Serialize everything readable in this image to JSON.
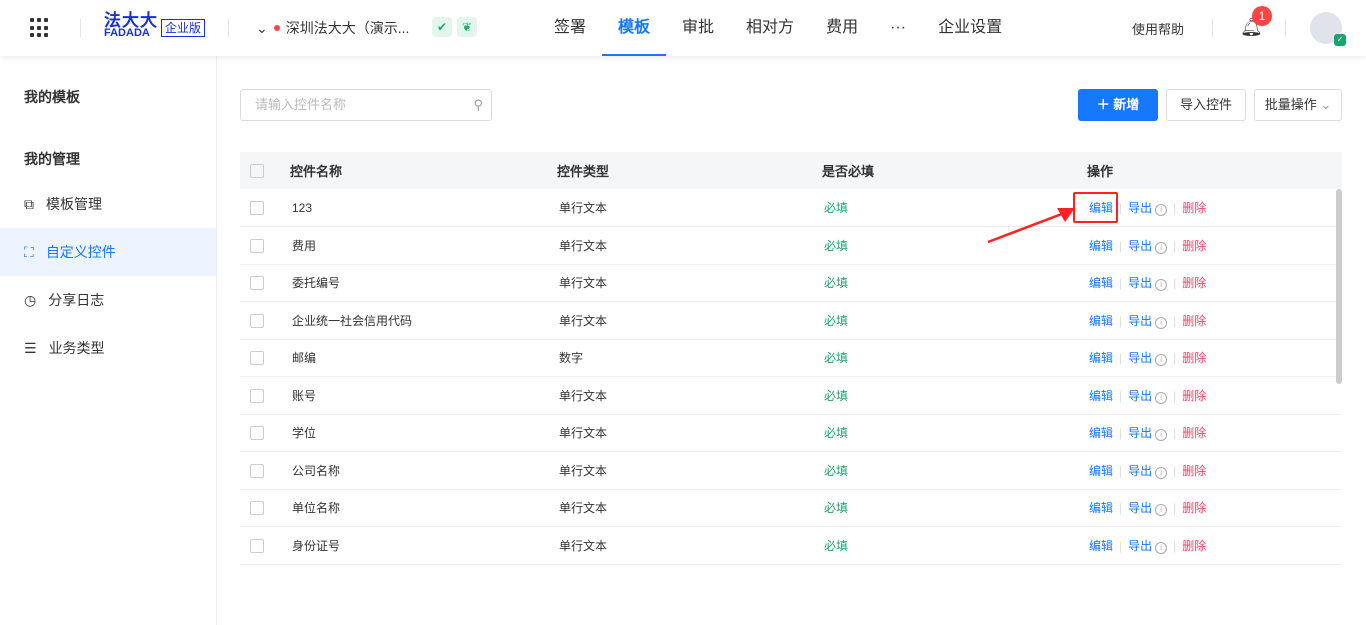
{
  "header": {
    "brand": "法大大",
    "brand_sub": "FADADA",
    "edition": "企业版",
    "org": "深圳法大大（演示...",
    "nav": [
      "签署",
      "模板",
      "审批",
      "相对方",
      "费用",
      "···",
      "企业设置"
    ],
    "active_nav": 1,
    "help": "使用帮助",
    "notifications": "1"
  },
  "sidebar": {
    "my_templates": "我的模板",
    "my_manage": "我的管理",
    "items": [
      {
        "label": "模板管理",
        "icon": "⧉"
      },
      {
        "label": "自定义控件",
        "icon": "⛶"
      },
      {
        "label": "分享日志",
        "icon": "◷"
      },
      {
        "label": "业务类型",
        "icon": "☰"
      }
    ],
    "active": 1
  },
  "toolbar": {
    "search_placeholder": "请输入控件名称",
    "add": "＋ 新增",
    "import": "导入控件",
    "batch": "批量操作"
  },
  "table": {
    "headers": [
      "控件名称",
      "控件类型",
      "是否必填",
      "操作"
    ],
    "rows": [
      [
        "123",
        "单行文本",
        "必填"
      ],
      [
        "费用",
        "单行文本",
        "必填"
      ],
      [
        "委托编号",
        "单行文本",
        "必填"
      ],
      [
        "企业统一社会信用代码",
        "单行文本",
        "必填"
      ],
      [
        "邮编",
        "数字",
        "必填"
      ],
      [
        "账号",
        "单行文本",
        "必填"
      ],
      [
        "学位",
        "单行文本",
        "必填"
      ],
      [
        "公司名称",
        "单行文本",
        "必填"
      ],
      [
        "单位名称",
        "单行文本",
        "必填"
      ],
      [
        "身份证号",
        "单行文本",
        "必填"
      ]
    ],
    "actions": {
      "edit": "编辑",
      "export": "导出",
      "delete": "删除"
    }
  }
}
